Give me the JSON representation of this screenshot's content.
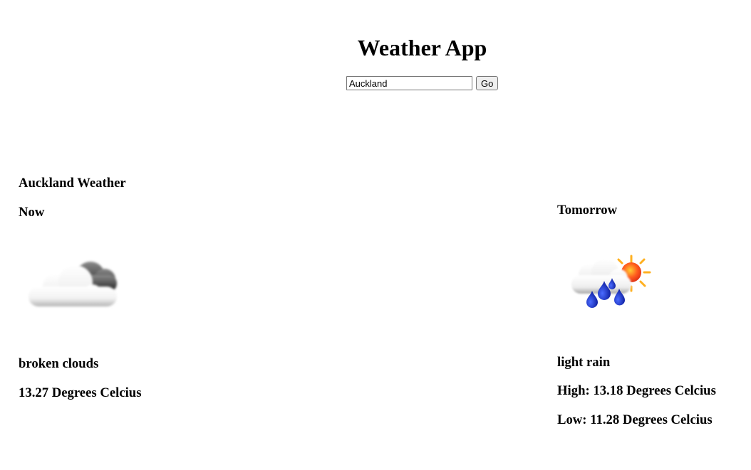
{
  "app": {
    "title": "Weather App"
  },
  "search": {
    "value": "Auckland",
    "button_label": "Go"
  },
  "current": {
    "heading": "Auckland Weather",
    "label": "Now",
    "icon": "broken-clouds-icon",
    "description": "broken clouds",
    "temperature": "13.27 Degrees Celcius"
  },
  "forecast": {
    "label": "Tomorrow",
    "icon": "light-rain-icon",
    "description": "light rain",
    "high": "High: 13.18 Degrees Celcius",
    "low": "Low: 11.28 Degrees Celcius"
  }
}
